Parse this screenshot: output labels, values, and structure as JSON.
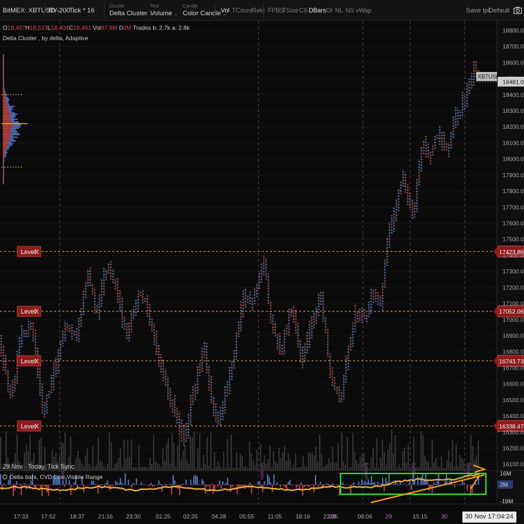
{
  "toolbar": {
    "symbol": "BitMEX: XBTUSD",
    "preset": "RY-200",
    "aggregation": "Tick * 16",
    "cluster_caption": "Cluster",
    "cluster_value": "Delta Cluster",
    "text_caption": "Text",
    "text_value": "Volume",
    "candle_caption": "Candle",
    "candle_value": "Color Candle",
    "toggles": [
      {
        "label": "Vol",
        "on": true
      },
      {
        "label": "TCount",
        "on": false
      },
      {
        "label": "Rekt",
        "on": false
      },
      {
        "label": "FPBS",
        "on": false
      },
      {
        "label": "TSize",
        "on": false
      },
      {
        "label": "CS",
        "on": false
      },
      {
        "label": "DBars",
        "on": true
      },
      {
        "label": "OI",
        "on": false
      },
      {
        "label": "NL",
        "on": false
      },
      {
        "label": "NS",
        "on": false
      },
      {
        "label": "vWap",
        "on": false
      }
    ],
    "save_tpl": "Save tpl",
    "default": "Default"
  },
  "legend": {
    "o_label": "O",
    "o_val": "18,497",
    "h_label": "H",
    "h_val": "18,533",
    "l_label": "L",
    "l_val": "18,404",
    "c_label": "C",
    "c_val": "18,481",
    "vol_label": "Vol",
    "vol_val": "87.9M",
    "d_label": "D",
    "d_val": "2M",
    "trades": "Trades b: 2.7k a: 2.8k",
    "indicator": "Delta Cluster , by delta, Adaptive"
  },
  "session_info": "29 Nov  ·  Today, Tick Sync",
  "session_marker": "Session",
  "symbol_tag": "XBTUSD",
  "date_chip": "30 Nov 17:04:24",
  "colors": {
    "background": "#0b0b0b",
    "bull": "#5a7fd6",
    "bear": "#d24a4a",
    "level_line": "#d9a13a",
    "level_box": "#8e1a1a",
    "cvd_line": "#f2b134",
    "highlight_box": "#22dd22",
    "arrow": "#ff9a1f",
    "session_line": "#a04aa8"
  },
  "chart_data": {
    "type": "candlestick",
    "symbol": "XBTUSD",
    "price_axis_ticks": [
      18800,
      18700,
      18600,
      18500,
      18400,
      18300,
      18200,
      18100,
      18000,
      17900,
      17800,
      17700,
      17600,
      17500,
      17400,
      17300,
      17200,
      17100,
      17000,
      16900,
      16800,
      16700,
      16600,
      16500,
      16400,
      16300,
      16200,
      16100
    ],
    "price_axis_labels": [
      "18800.0",
      "18700.0",
      "18600.0",
      "18500.0",
      "18400.0",
      "18300.0",
      "18200.0",
      "18100.0",
      "18000.0",
      "17900.0",
      "17800.0",
      "17700.0",
      "17600.0",
      "17500.0",
      "17400.0",
      "17300.0",
      "17200.0",
      "17100.0",
      "17000.0",
      "16900.0",
      "16800.0",
      "16700.0",
      "16600.0",
      "16500.0",
      "16400.0",
      "16300.0",
      "16200.0",
      "16100.0"
    ],
    "ylim": [
      16060,
      18860
    ],
    "last_price": {
      "value": 18481,
      "label": "18481.0"
    },
    "levels": [
      {
        "label": "Level",
        "close_mark": "X",
        "price": 17423.86,
        "price_label": "17423.86"
      },
      {
        "label": "Level",
        "close_mark": "X",
        "price": 17052.06,
        "price_label": "17052.06"
      },
      {
        "label": "Level",
        "close_mark": "X",
        "price": 16743.73,
        "price_label": "16743.73"
      },
      {
        "label": "Level",
        "close_mark": "X",
        "price": 16338.47,
        "price_label": "16338.47"
      }
    ],
    "time_axis": [
      {
        "label": "17:33",
        "pos": 0.04
      },
      {
        "label": "17:52",
        "pos": 0.095
      },
      {
        "label": "18:37",
        "pos": 0.153
      },
      {
        "label": "21:16",
        "pos": 0.21
      },
      {
        "label": "23:30",
        "pos": 0.266
      },
      {
        "label": "01:25",
        "pos": 0.326
      },
      {
        "label": "02:35",
        "pos": 0.381
      },
      {
        "label": "04:28",
        "pos": 0.438
      },
      {
        "label": "05:55",
        "pos": 0.494
      },
      {
        "label": "11:05",
        "pos": 0.551
      },
      {
        "label": "18:16",
        "pos": 0.607
      },
      {
        "label": "23:05",
        "pos": 0.663
      },
      {
        "label": "28",
        "pos": 0.675,
        "magenta": true
      },
      {
        "label": "08:06",
        "pos": 0.732
      },
      {
        "label": "29",
        "pos": 0.788,
        "magenta": true
      },
      {
        "label": "15:15",
        "pos": 0.843
      },
      {
        "label": "30",
        "pos": 0.9,
        "magenta": true
      }
    ],
    "session_breaks": [
      0.12,
      0.52,
      0.73,
      0.825,
      0.935
    ],
    "price_path": [
      [
        0.0,
        16850
      ],
      [
        0.02,
        16520
      ],
      [
        0.045,
        16920
      ],
      [
        0.065,
        16980
      ],
      [
        0.085,
        16420
      ],
      [
        0.105,
        16640
      ],
      [
        0.13,
        16960
      ],
      [
        0.155,
        16900
      ],
      [
        0.175,
        17290
      ],
      [
        0.195,
        17060
      ],
      [
        0.215,
        17340
      ],
      [
        0.235,
        17180
      ],
      [
        0.255,
        16900
      ],
      [
        0.28,
        17200
      ],
      [
        0.305,
        16980
      ],
      [
        0.33,
        16620
      ],
      [
        0.355,
        16400
      ],
      [
        0.37,
        16250
      ],
      [
        0.39,
        16560
      ],
      [
        0.41,
        16820
      ],
      [
        0.425,
        16500
      ],
      [
        0.44,
        16380
      ],
      [
        0.465,
        16700
      ],
      [
        0.49,
        17150
      ],
      [
        0.51,
        17110
      ],
      [
        0.53,
        17380
      ],
      [
        0.545,
        17000
      ],
      [
        0.565,
        16800
      ],
      [
        0.585,
        17100
      ],
      [
        0.605,
        16760
      ],
      [
        0.625,
        16950
      ],
      [
        0.645,
        17150
      ],
      [
        0.665,
        16650
      ],
      [
        0.685,
        16500
      ],
      [
        0.7,
        16800
      ],
      [
        0.715,
        17050
      ],
      [
        0.735,
        16990
      ],
      [
        0.75,
        17200
      ],
      [
        0.765,
        17100
      ],
      [
        0.78,
        17500
      ],
      [
        0.795,
        17700
      ],
      [
        0.81,
        17900
      ],
      [
        0.83,
        17650
      ],
      [
        0.85,
        18100
      ],
      [
        0.865,
        18030
      ],
      [
        0.88,
        18160
      ],
      [
        0.9,
        18060
      ],
      [
        0.915,
        18250
      ],
      [
        0.93,
        18340
      ],
      [
        0.945,
        18450
      ],
      [
        0.955,
        18600
      ],
      [
        0.965,
        18481
      ]
    ],
    "volume_profile_price": [
      18650,
      18400,
      18250,
      18100,
      17950,
      17850
    ],
    "lower_pane": {
      "title": "Delta bars, CVD Line Visible Range",
      "axis_labels": [
        "16M",
        "2M",
        "-19M"
      ],
      "axis_values": [
        16,
        2,
        -19
      ]
    }
  }
}
